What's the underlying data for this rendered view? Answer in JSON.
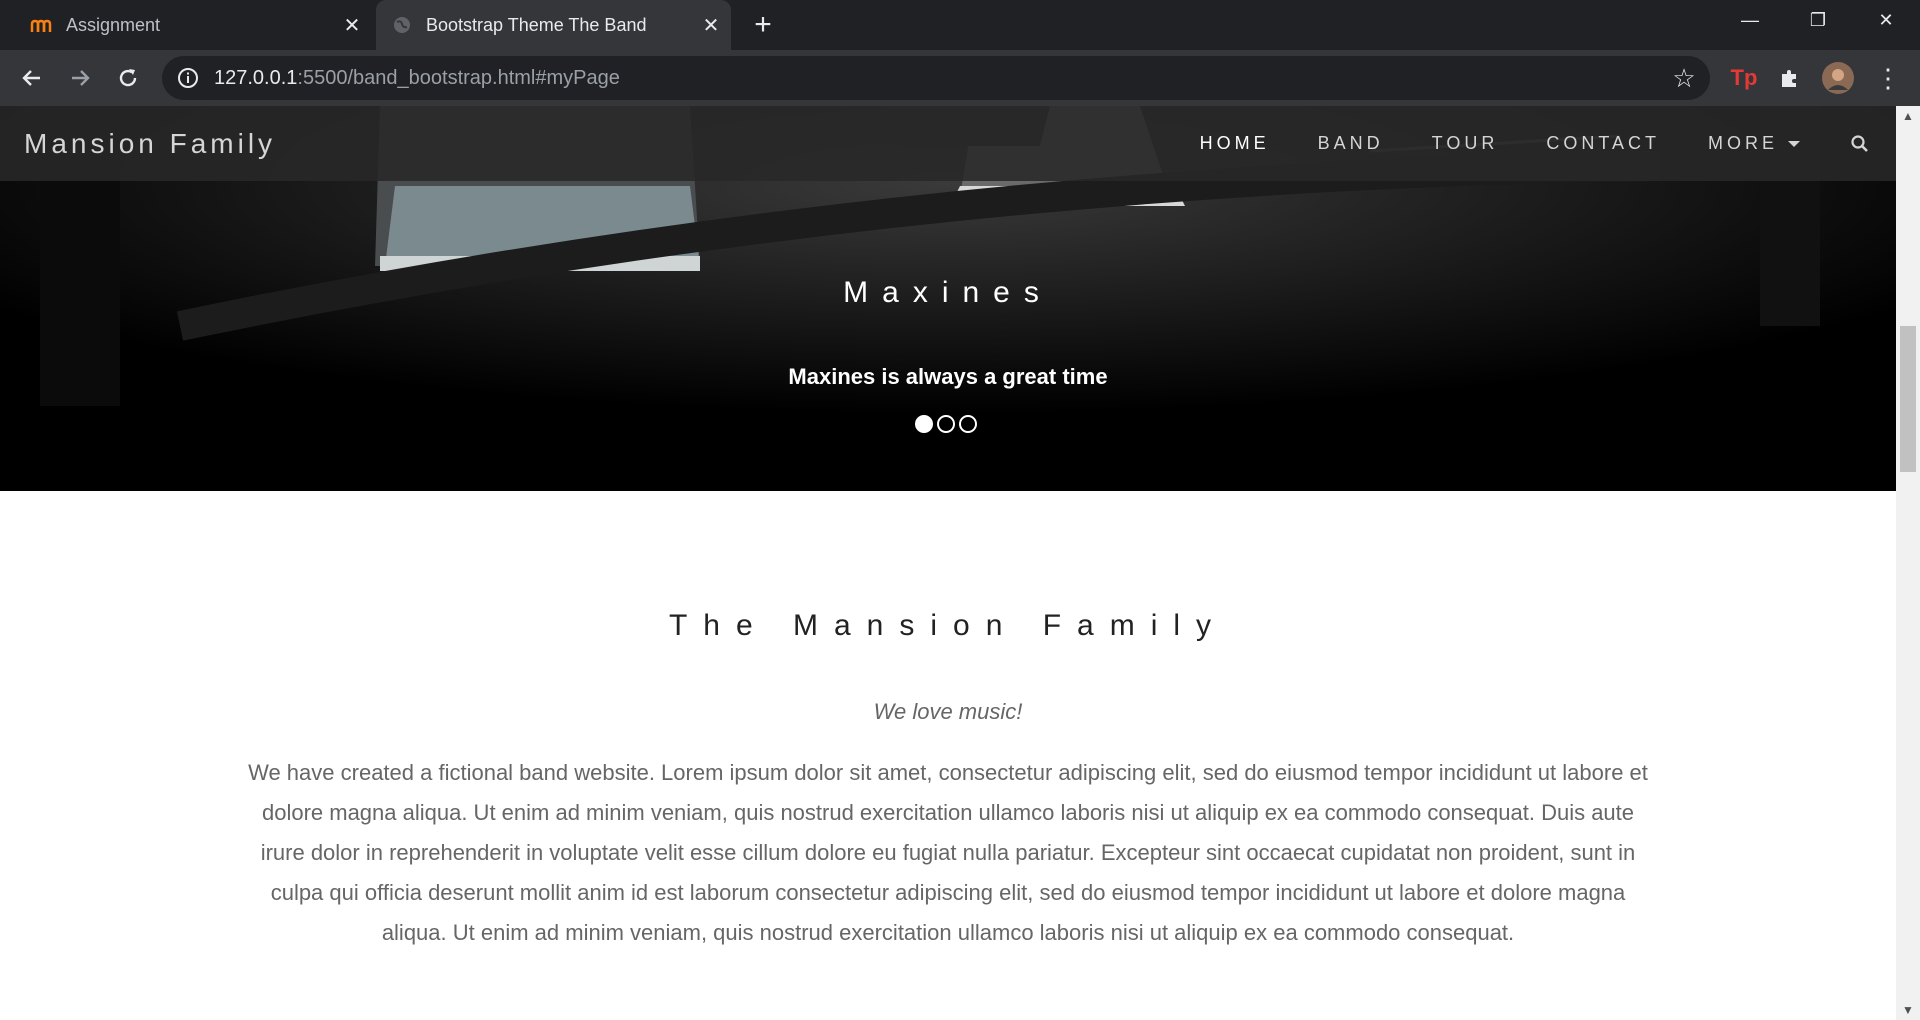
{
  "browser": {
    "tabs": [
      {
        "title": "Assignment",
        "icon": "moodle-icon",
        "active": false
      },
      {
        "title": "Bootstrap Theme The Band",
        "icon": "globe-icon",
        "active": true
      }
    ],
    "new_tab_label": "+",
    "url_host": "127.0.0.1",
    "url_rest": ":5500/band_bootstrap.html#myPage",
    "extension_tp_label": "Tp"
  },
  "site": {
    "brand": "Mansion Family",
    "nav": [
      {
        "label": "HOME"
      },
      {
        "label": "BAND"
      },
      {
        "label": "TOUR"
      },
      {
        "label": "CONTACT"
      },
      {
        "label": "MORE"
      }
    ],
    "carousel": {
      "title": "Maxines",
      "caption": "Maxines is always a great time",
      "slide_count": 3,
      "active_slide": 1
    },
    "about": {
      "title": "The Mansion Family",
      "tagline": "We love music!",
      "body": "We have created a fictional band website. Lorem ipsum dolor sit amet, consectetur adipiscing elit, sed do eiusmod tempor incididunt ut labore et dolore magna aliqua. Ut enim ad minim veniam, quis nostrud exercitation ullamco laboris nisi ut aliquip ex ea commodo consequat. Duis aute irure dolor in reprehenderit in voluptate velit esse cillum dolore eu fugiat nulla pariatur. Excepteur sint occaecat cupidatat non proident, sunt in culpa qui officia deserunt mollit anim id est laborum consectetur adipiscing elit, sed do eiusmod tempor incididunt ut labore et dolore magna aliqua. Ut enim ad minim veniam, quis nostrud exercitation ullamco laboris nisi ut aliquip ex ea commodo consequat."
    }
  },
  "colors": {
    "chrome_dark": "#202124",
    "chrome_toolbar": "#35363a",
    "site_nav": "#282828",
    "extension_red": "#e53935"
  }
}
